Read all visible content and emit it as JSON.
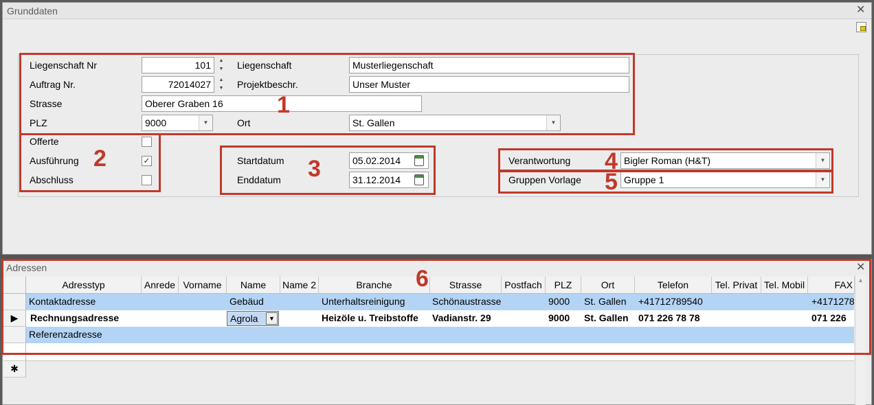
{
  "window_top": {
    "title": "Grunddaten",
    "close_glyph": "✕"
  },
  "fields": {
    "liegenschaft_nr": {
      "label": "Liegenschaft Nr",
      "value": "101"
    },
    "liegenschaft": {
      "label": "Liegenschaft",
      "value": "Musterliegenschaft"
    },
    "auftrag_nr": {
      "label": "Auftrag Nr.",
      "value": "72014027"
    },
    "projektbeschr": {
      "label": "Projektbeschr.",
      "value": "Unser Muster"
    },
    "strasse": {
      "label": "Strasse",
      "value": "Oberer Graben 16"
    },
    "plz": {
      "label": "PLZ",
      "value": "9000"
    },
    "ort": {
      "label": "Ort",
      "value": "St. Gallen"
    }
  },
  "status": {
    "offerte": {
      "label": "Offerte",
      "checked": false
    },
    "ausfuehrung": {
      "label": "Ausführung",
      "checked": true
    },
    "abschluss": {
      "label": "Abschluss",
      "checked": false
    }
  },
  "dates": {
    "start": {
      "label": "Startdatum",
      "value": "05.02.2014"
    },
    "end": {
      "label": "Enddatum",
      "value": "31.12.2014"
    }
  },
  "assign": {
    "verantwortung": {
      "label": "Verantwortung",
      "value": "Bigler Roman (H&T)"
    },
    "gruppen_vorlage": {
      "label": "Gruppen Vorlage",
      "value": "Gruppe 1"
    }
  },
  "annotations": [
    "1",
    "2",
    "3",
    "4",
    "5",
    "6"
  ],
  "window_bottom": {
    "title": "Adressen",
    "close_glyph": "✕"
  },
  "grid": {
    "columns": [
      "Adresstyp",
      "Anrede",
      "Vorname",
      "Name",
      "Name 2",
      "Branche",
      "Strasse",
      "Postfach",
      "PLZ",
      "Ort",
      "Telefon",
      "Tel. Privat",
      "Tel. Mobil",
      "FAX"
    ],
    "rows": [
      {
        "adresstyp": "Kontaktadresse",
        "anrede": "",
        "vorname": "",
        "name": "Gebäud",
        "name2": "",
        "branche": "Unterhaltsreinigung",
        "strasse": "Schönaustrasse",
        "postfach": "",
        "plz": "9000",
        "ort": "St. Gallen",
        "telefon": "+41712789540",
        "tel_privat": "",
        "tel_mobil": "",
        "fax": "+4171278"
      },
      {
        "adresstyp": "Rechnungsadresse",
        "anrede": "",
        "vorname": "",
        "name": "Agrola",
        "name2": "",
        "branche": "Heizöle u. Treibstoffe",
        "strasse": "Vadianstr. 29",
        "postfach": "",
        "plz": "9000",
        "ort": "St. Gallen",
        "telefon": "071 226 78 78",
        "tel_privat": "",
        "tel_mobil": "",
        "fax": "071 226"
      },
      {
        "adresstyp": "Referenzadresse",
        "anrede": "",
        "vorname": "",
        "name": "",
        "name2": "",
        "branche": "",
        "strasse": "",
        "postfach": "",
        "plz": "",
        "ort": "",
        "telefon": "",
        "tel_privat": "",
        "tel_mobil": "",
        "fax": ""
      }
    ],
    "current_row_glyph": "▶",
    "new_row_glyph": "✱"
  },
  "colors": {
    "highlight_row": "#b3d4f5",
    "annotation_red": "#c0392b"
  }
}
